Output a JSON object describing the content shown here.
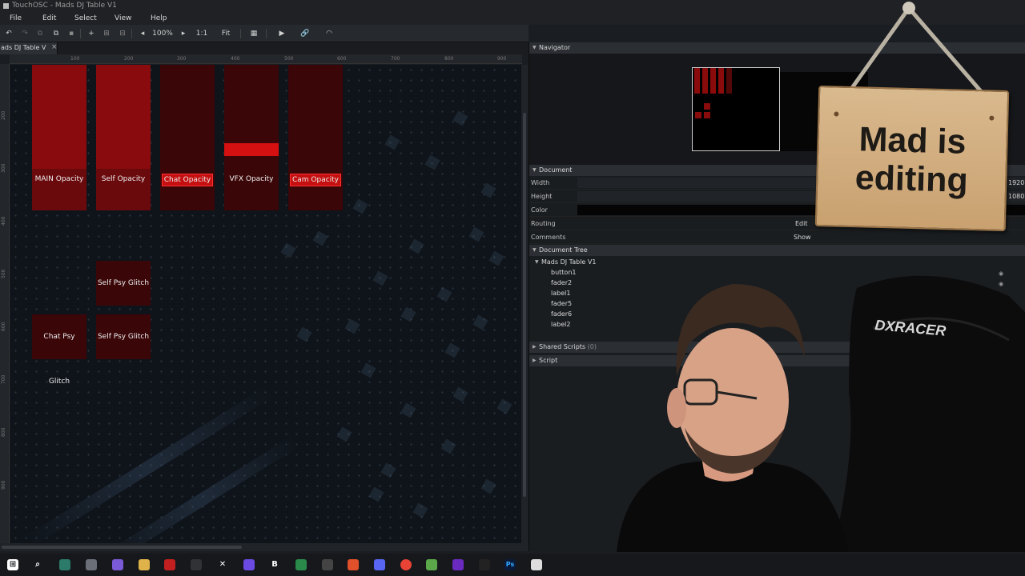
{
  "window": {
    "title": "TouchOSC - Mads DJ Table V1"
  },
  "menu": {
    "items": [
      "File",
      "Edit",
      "Select",
      "View",
      "Help"
    ]
  },
  "toolbar": {
    "zoom_label": "100%",
    "one_to_one_label": "1:1",
    "fit_label": "Fit",
    "icons": [
      "undo-icon",
      "redo-icon",
      "copy-icon",
      "paste-icon",
      "delete-icon",
      "add-icon",
      "align-icon",
      "distribute-icon",
      "zoom-out-icon",
      "zoom-in-icon",
      "grid-icon",
      "play-icon",
      "link-icon",
      "wifi-icon"
    ]
  },
  "tab": {
    "label": "ads DJ Table V",
    "close": "×"
  },
  "ruler": {
    "top_ticks": [
      "100",
      "200",
      "300",
      "400",
      "500",
      "600",
      "700",
      "800",
      "900"
    ],
    "left_ticks": [
      "200",
      "300",
      "400",
      "500",
      "600",
      "700",
      "800",
      "900"
    ]
  },
  "canvas": {
    "faders": [
      {
        "label": "MAIN Opacity",
        "value": 1.0,
        "highlight": false
      },
      {
        "label": "Self Opacity",
        "value": 1.0,
        "highlight": false
      },
      {
        "label": "Chat Opacity",
        "value": 0.0,
        "highlight": true
      },
      {
        "label": "VFX Opacity",
        "value": 0.5,
        "highlight": false
      },
      {
        "label": "Cam Opacity",
        "value": 0.0,
        "highlight": true
      }
    ],
    "buttons": [
      {
        "label": "Self  Psy Glitch"
      },
      {
        "label": "Chat Psy Glitch"
      },
      {
        "label": "Self  Psy Glitch"
      }
    ]
  },
  "navigator": {
    "title": "Navigator"
  },
  "document": {
    "title": "Document",
    "width_label": "Width",
    "width_value": "1920",
    "height_label": "Height",
    "height_value": "1080",
    "color_label": "Color",
    "routing_label": "Routing",
    "routing_value": "Edit",
    "comments_label": "Comments",
    "comments_value": "Show"
  },
  "tree": {
    "title": "Document Tree",
    "root": "Mads DJ Table V1",
    "children": [
      "button1",
      "fader2",
      "label1",
      "fader5",
      "fader6",
      "label2"
    ]
  },
  "shared_scripts": {
    "title": "Shared Scripts",
    "count": "(0)"
  },
  "script": {
    "title": "Script"
  },
  "sign": {
    "line1": "Mad is",
    "line2": "editing"
  },
  "chair_brand": "DXRACER",
  "taskbar": {
    "icons": [
      "windows-icon",
      "search-icon",
      "app-icon",
      "app-icon",
      "app-icon",
      "folder-icon",
      "voicemeeter-icon",
      "obs-icon",
      "capcut-icon",
      "app-icon",
      "b-icon",
      "app-icon",
      "app-icon",
      "brave-icon",
      "discord-icon",
      "chrome-icon",
      "app-icon",
      "app-icon",
      "app-icon",
      "photoshop-icon",
      "file-icon"
    ],
    "b_label": "B",
    "ps_label": "Ps"
  }
}
